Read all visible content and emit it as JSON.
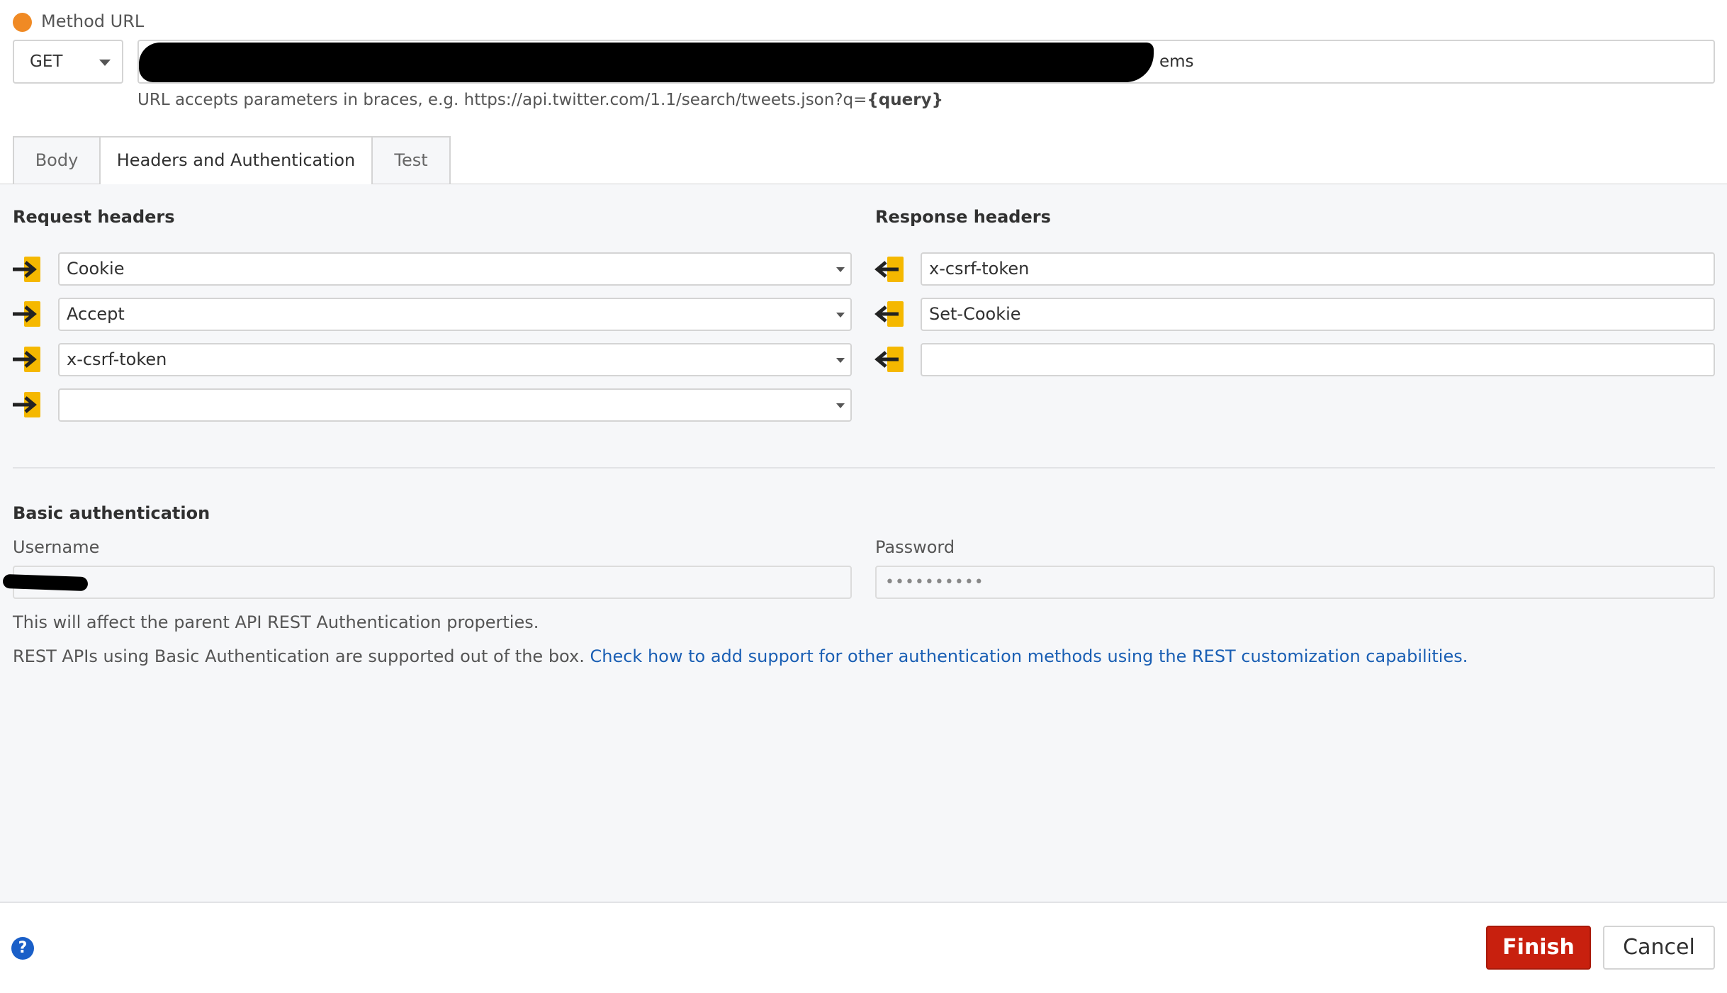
{
  "method_url": {
    "label": "Method URL",
    "method": "GET",
    "url_visible_suffix": "ems",
    "hint_prefix": "URL accepts parameters in braces, e.g. https://api.twitter.com/1.1/search/tweets.json?q=",
    "hint_param": "{query}"
  },
  "tabs": [
    {
      "label": "Body"
    },
    {
      "label": "Headers and Authentication"
    },
    {
      "label": "Test"
    }
  ],
  "request_headers": {
    "title": "Request headers",
    "items": [
      "Cookie",
      "Accept",
      "x-csrf-token",
      ""
    ]
  },
  "response_headers": {
    "title": "Response headers",
    "items": [
      "x-csrf-token",
      "Set-Cookie",
      ""
    ]
  },
  "basic_auth": {
    "title": "Basic authentication",
    "username_label": "Username",
    "password_label": "Password",
    "password_value": "••••••••••",
    "note1": "This will affect the parent API REST Authentication properties.",
    "note2": "REST APIs using Basic Authentication are supported out of the box.",
    "note2_link": "Check how to add support for other authentication methods using the REST customization capabilities."
  },
  "footer": {
    "help": "?",
    "finish": "Finish",
    "cancel": "Cancel"
  },
  "colors": {
    "status_dot": "#f08a24",
    "finish_button": "#c8200e",
    "link": "#1a5fb4",
    "header_icon": "#f5b800"
  },
  "icons": {
    "request": "arrow-right-into-box-icon",
    "response": "arrow-left-out-of-box-icon"
  }
}
